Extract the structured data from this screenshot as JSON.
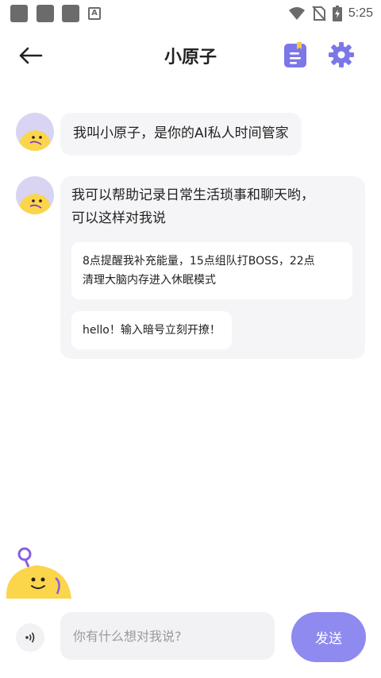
{
  "status_bar": {
    "time": "5:25",
    "icons": [
      "wifi-icon",
      "no-sim-icon",
      "battery-charging-icon"
    ]
  },
  "header": {
    "title": "小原子",
    "back_icon": "arrow-left-icon",
    "notes_icon": "document-icon",
    "settings_icon": "gear-icon"
  },
  "colors": {
    "accent": "#8f8af0",
    "bubble": "#f5f5f7",
    "icon": "#7b77e6",
    "mascot": "#fbd54a"
  },
  "messages": [
    {
      "text": "我叫小原子，是你的AI私人时间管家"
    },
    {
      "lines": [
        "我可以帮助记录日常生活琐事和聊天哟，",
        "可以这样对我说"
      ],
      "suggestions": [
        {
          "lines": [
            "8点提醒我补充能量，15点组队打BOSS，22点",
            "清理大脑内存进入休眠模式"
          ]
        },
        {
          "text": "hello！输入暗号立刻开撩！"
        }
      ]
    }
  ],
  "input": {
    "placeholder": "你有什么想对我说?",
    "value": ""
  },
  "send_label": "发送"
}
